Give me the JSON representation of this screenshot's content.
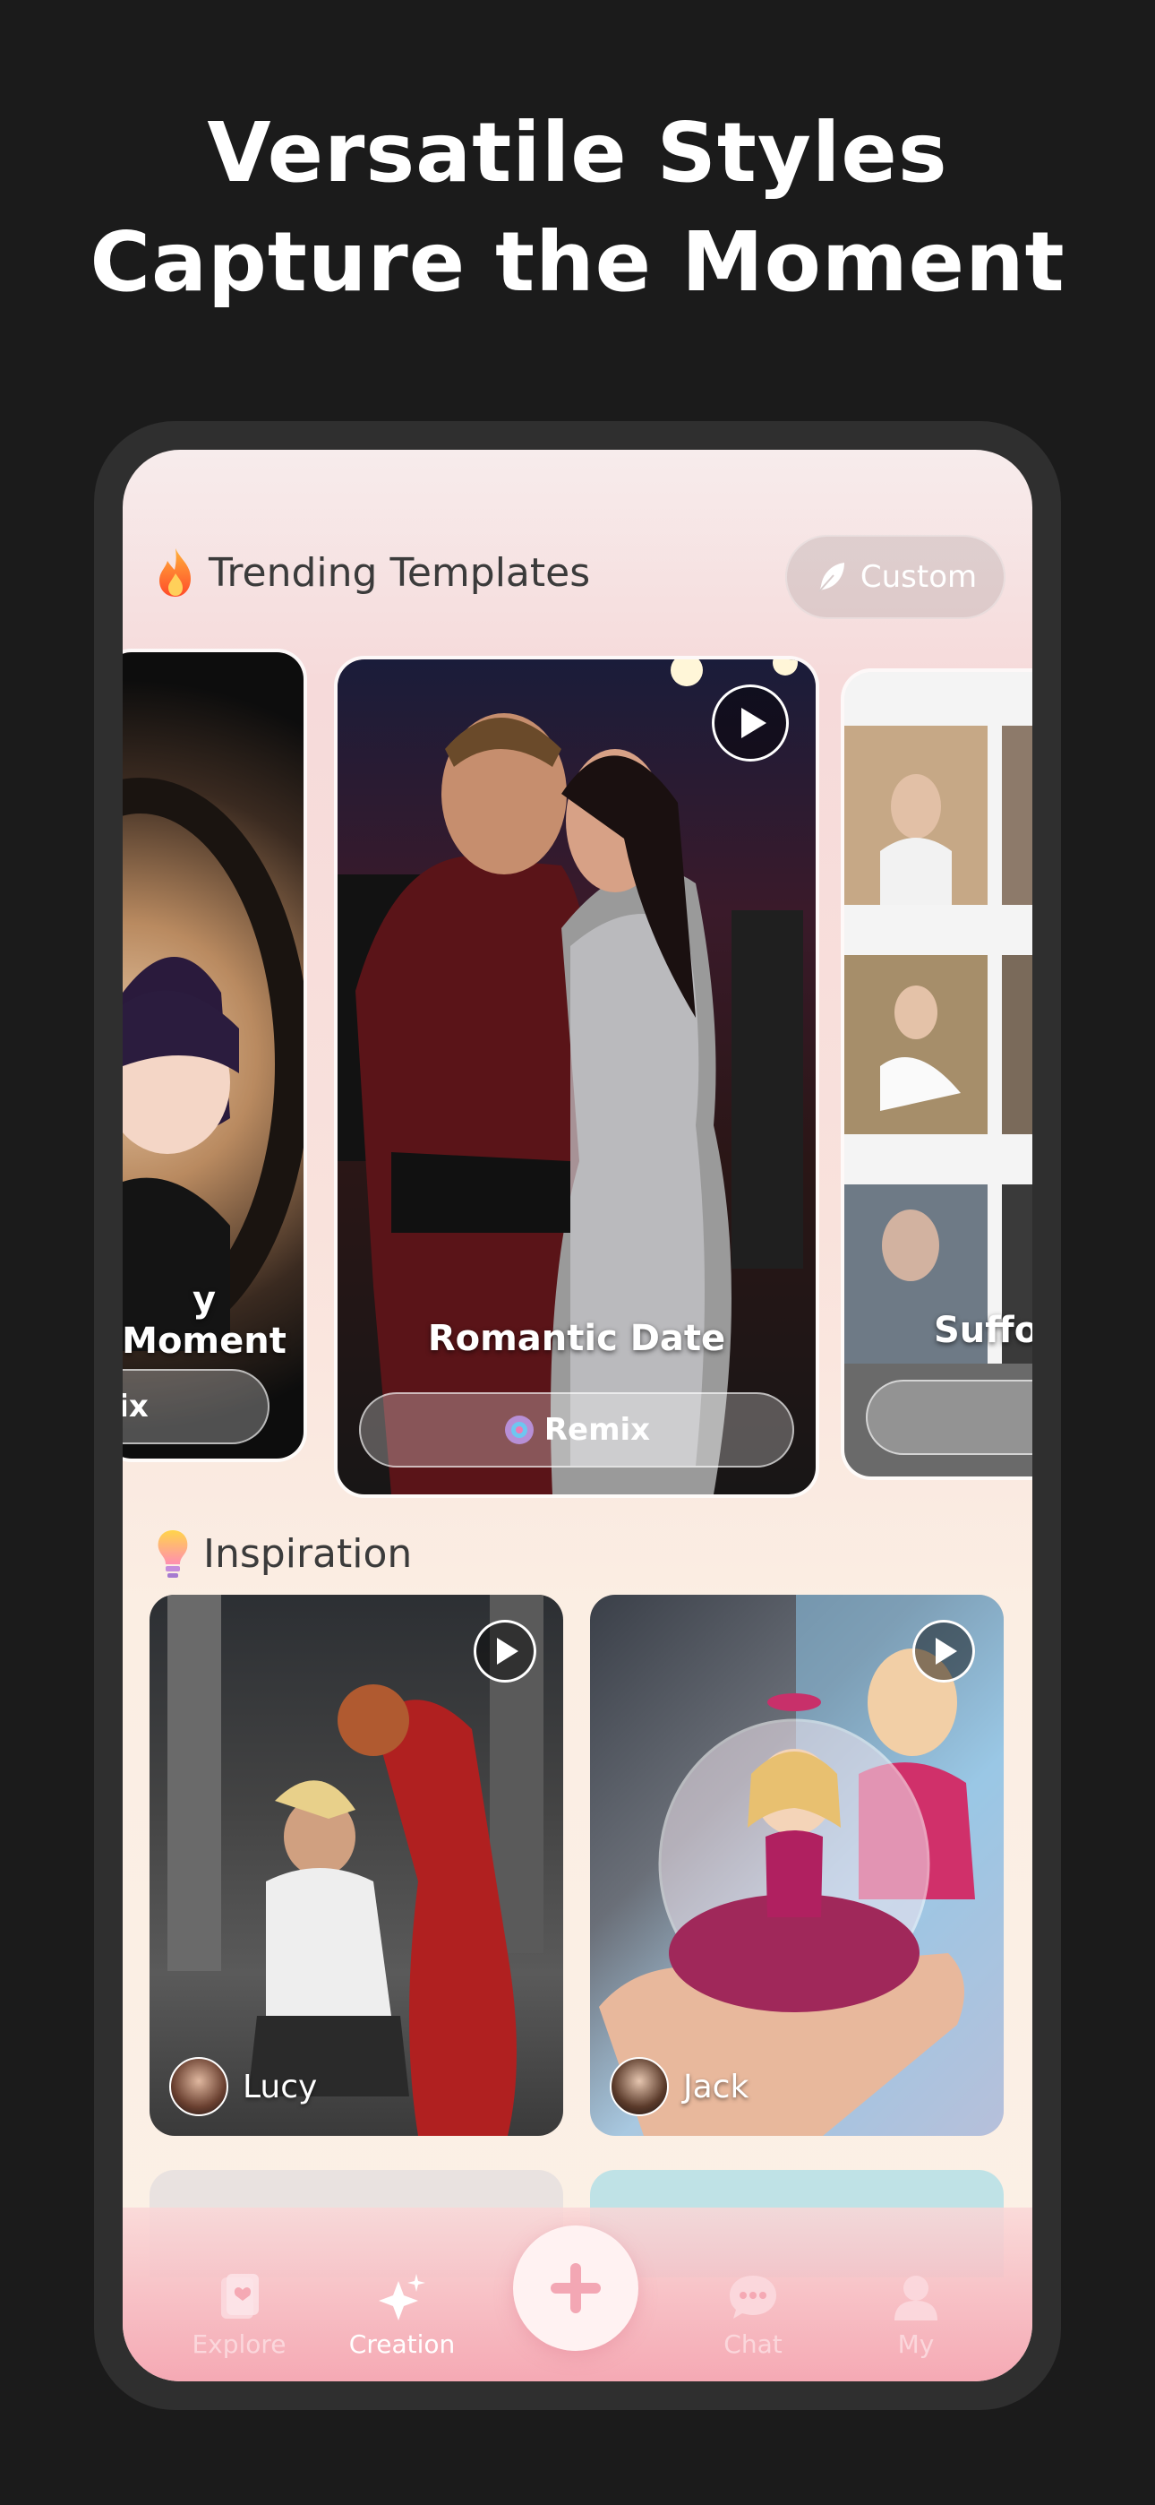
{
  "headline": {
    "line1": "Versatile Styles",
    "line2": "Capture the Moment"
  },
  "trending": {
    "title": "Trending Templates",
    "custom_label": "Custom",
    "cards": [
      {
        "title": "y Moment",
        "button": "ix"
      },
      {
        "title": "Romantic Date",
        "button": "Remix"
      },
      {
        "title": "Suffoc",
        "button": ""
      }
    ]
  },
  "inspiration": {
    "title": "Inspiration",
    "cards": [
      {
        "author": "Lucy"
      },
      {
        "author": "Jack"
      }
    ]
  },
  "tabs": [
    {
      "label": "Explore",
      "icon": "card-icon"
    },
    {
      "label": "Creation",
      "icon": "sparkle-icon"
    },
    {
      "label": "Chat",
      "icon": "chat-icon"
    },
    {
      "label": "My",
      "icon": "user-icon"
    }
  ],
  "colors": {
    "background": "#1b1b1b",
    "accent_pink": "#f5a9b4"
  }
}
